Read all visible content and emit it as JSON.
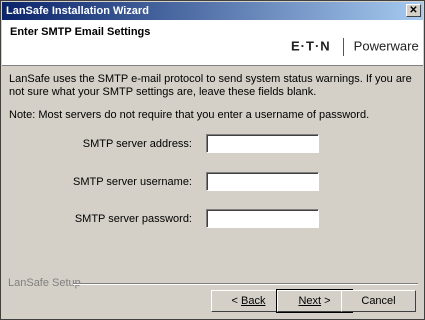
{
  "window": {
    "title": "LanSafe Installation Wizard",
    "close_glyph": "✕"
  },
  "header": {
    "heading": "Enter SMTP Email Settings",
    "logo_eaton": "E·T·N",
    "logo_powerware": "Powerware"
  },
  "content": {
    "description": "LanSafe uses the SMTP e-mail protocol to send system status warnings. If you are not sure what your SMTP settings are, leave these fields blank.",
    "note": "Note: Most servers do not require that you enter a username of password."
  },
  "form": {
    "address_label": "SMTP server address:",
    "address_value": "",
    "username_label": "SMTP server username:",
    "username_value": "",
    "password_label": "SMTP server password:",
    "password_value": ""
  },
  "footer": {
    "group_label": "LanSafe Setup",
    "back_label": "Back",
    "next_label": "Next",
    "cancel_label": "Cancel"
  }
}
